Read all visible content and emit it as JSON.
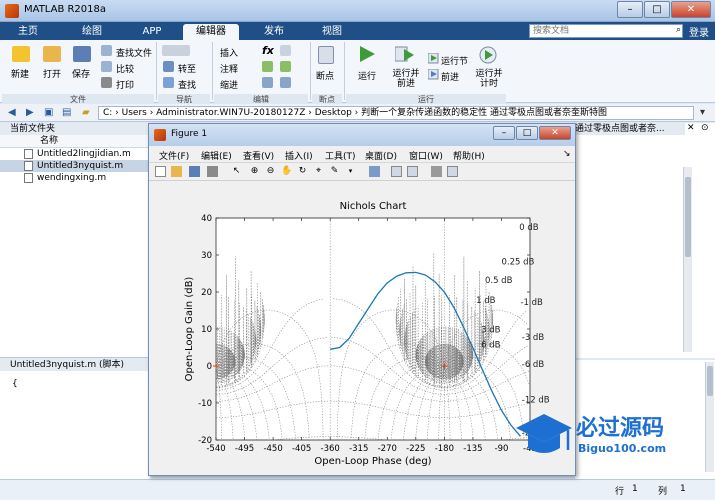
{
  "window": {
    "title": "MATLAB R2018a",
    "min": "–",
    "max": "□",
    "close": "✕"
  },
  "tabs": [
    {
      "label": "主页"
    },
    {
      "label": "绘图"
    },
    {
      "label": "APP"
    },
    {
      "label": "编辑器"
    },
    {
      "label": "发布"
    },
    {
      "label": "视图"
    }
  ],
  "search": {
    "placeholder": "搜索文档"
  },
  "login": "登录",
  "ribbon": {
    "file": {
      "new": "新建",
      "open": "打开",
      "save": "保存",
      "find_files": "查找文件",
      "compare": "比较",
      "print": "打印",
      "group": "文件"
    },
    "nav": {
      "goto": "转至",
      "find": "查找",
      "group": "导航"
    },
    "edit": {
      "insert": "插入",
      "comment": "注释",
      "indent": "缩进",
      "fx": "fx",
      "group": "编辑"
    },
    "breakpoints": {
      "label": "断点",
      "group": "断点"
    },
    "run": {
      "run": "运行",
      "run_advance": "运行并前进",
      "run_section": "运行节",
      "advance": "前进",
      "run_time": "运行并计时",
      "group": "运行"
    }
  },
  "address": {
    "path": "C: › Users › Administrator.WIN7U-20180127Z › Desktop › 判断一个复杂传递函数的稳定性 通过零极点图或者奈奎斯特图"
  },
  "file_panel": {
    "title": "当前文件夹",
    "column": "名称",
    "files": [
      {
        "name": "Untitled2lingjidian.m"
      },
      {
        "name": "Untitled3nyquist.m"
      },
      {
        "name": "wendingxing.m"
      }
    ]
  },
  "detail": {
    "title": "Untitled3nyquist.m (脚本)",
    "body": "{"
  },
  "right_pane": {
    "text": "通过零极点图或者奈..."
  },
  "status": {
    "row_label": "行",
    "row": "1",
    "col_label": "列",
    "col": "1"
  },
  "figure": {
    "title": "Figure 1",
    "menu": [
      "文件(F)",
      "编辑(E)",
      "查看(V)",
      "插入(I)",
      "工具(T)",
      "桌面(D)",
      "窗口(W)",
      "帮助(H)"
    ]
  },
  "chart_data": {
    "type": "line",
    "title": "Nichols Chart",
    "xlabel": "Open-Loop Phase (deg)",
    "ylabel": "Open-Loop Gain (dB)",
    "xlim": [
      -540,
      -45
    ],
    "ylim": [
      -20,
      40
    ],
    "x_ticks": [
      -540,
      -495,
      -450,
      -405,
      -360,
      -315,
      -270,
      -225,
      -180,
      -135,
      -90,
      -45
    ],
    "y_ticks": [
      -20,
      -10,
      0,
      10,
      20,
      30,
      40
    ],
    "grid": "Nichols grid (dotted)",
    "grid_labels": [
      "0 dB",
      "0.25 dB",
      "0.5 dB",
      "1 dB",
      "3 dB",
      "6 dB",
      "-1 dB",
      "-3 dB",
      "-6 dB",
      "-12 dB",
      "-20 dB"
    ],
    "critical_points": [
      [
        -540,
        0
      ],
      [
        -180,
        0
      ]
    ],
    "series": [
      {
        "color": "#1f77b4",
        "x": [
          -360,
          -345,
          -330,
          -315,
          -300,
          -285,
          -270,
          -255,
          -240,
          -225,
          -210,
          -195,
          -180,
          -165,
          -150,
          -135,
          -120,
          -105,
          -90,
          -75,
          -60
        ],
        "y": [
          4.5,
          5.0,
          7.5,
          11.5,
          15.5,
          19.5,
          22.5,
          24.3,
          25.2,
          25.3,
          24.6,
          22.8,
          20.0,
          15.8,
          10.6,
          4.9,
          -1.0,
          -6.8,
          -12.0,
          -16.0,
          -19.0
        ]
      }
    ]
  },
  "watermark": {
    "cn": "必过源码",
    "url": "Biguo100.com"
  }
}
